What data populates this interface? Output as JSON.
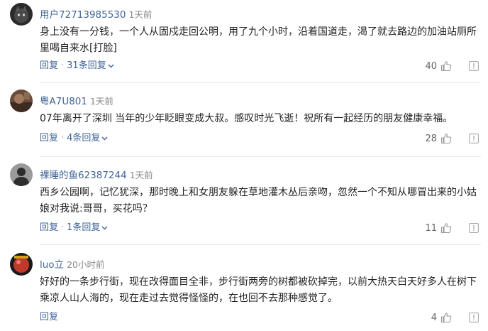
{
  "comments": [
    {
      "user": "用户72713985530",
      "time": "1天前",
      "content": "身上没有一分钱，一个人从固戍走回公明，用了九个小时，沿着国道走，渴了就去路边的加油站厕所里喝自来水[打脸]",
      "reply_label": "回复",
      "replies_label": "31条回复",
      "likes": "40",
      "avatar_icon": "dark-cat-avatar"
    },
    {
      "user": "粤A7U801",
      "time": "1天前",
      "content": "07年离开了深圳 当年的少年眨眼变成大叔。感叹时光飞逝！祝所有一起经历的朋友健康幸福。",
      "reply_label": "回复",
      "replies_label": "4条回复",
      "likes": "28",
      "avatar_icon": "brown-photo-avatar"
    },
    {
      "user": "裸睡的鱼62387244",
      "time": "1天前",
      "content": "西乡公园啊，记忆犹深，那时晚上和女朋友躲在草地灌木丛后亲吻，忽然一个不知从哪冒出来的小姑娘对我说:哥哥，买花吗？",
      "reply_label": "回复",
      "replies_label": "1条回复",
      "likes": "11",
      "avatar_icon": "person-silhouette-avatar"
    },
    {
      "user": "luo立",
      "time": "20小时前",
      "content": "好好的一条步行街，现在改得面目全非，步行街两旁的树都被砍掉完，以前大热天白天好多人在树下乘凉人山人海的，现在走过去觉得怪怪的，在也回不去那种感觉了。",
      "reply_label": "回复",
      "replies_label": "",
      "likes": "4",
      "avatar_icon": "red-sphere-avatar"
    }
  ],
  "colors": {
    "username": "#406599",
    "link": "#406599",
    "text": "#222222",
    "muted": "#888888"
  }
}
